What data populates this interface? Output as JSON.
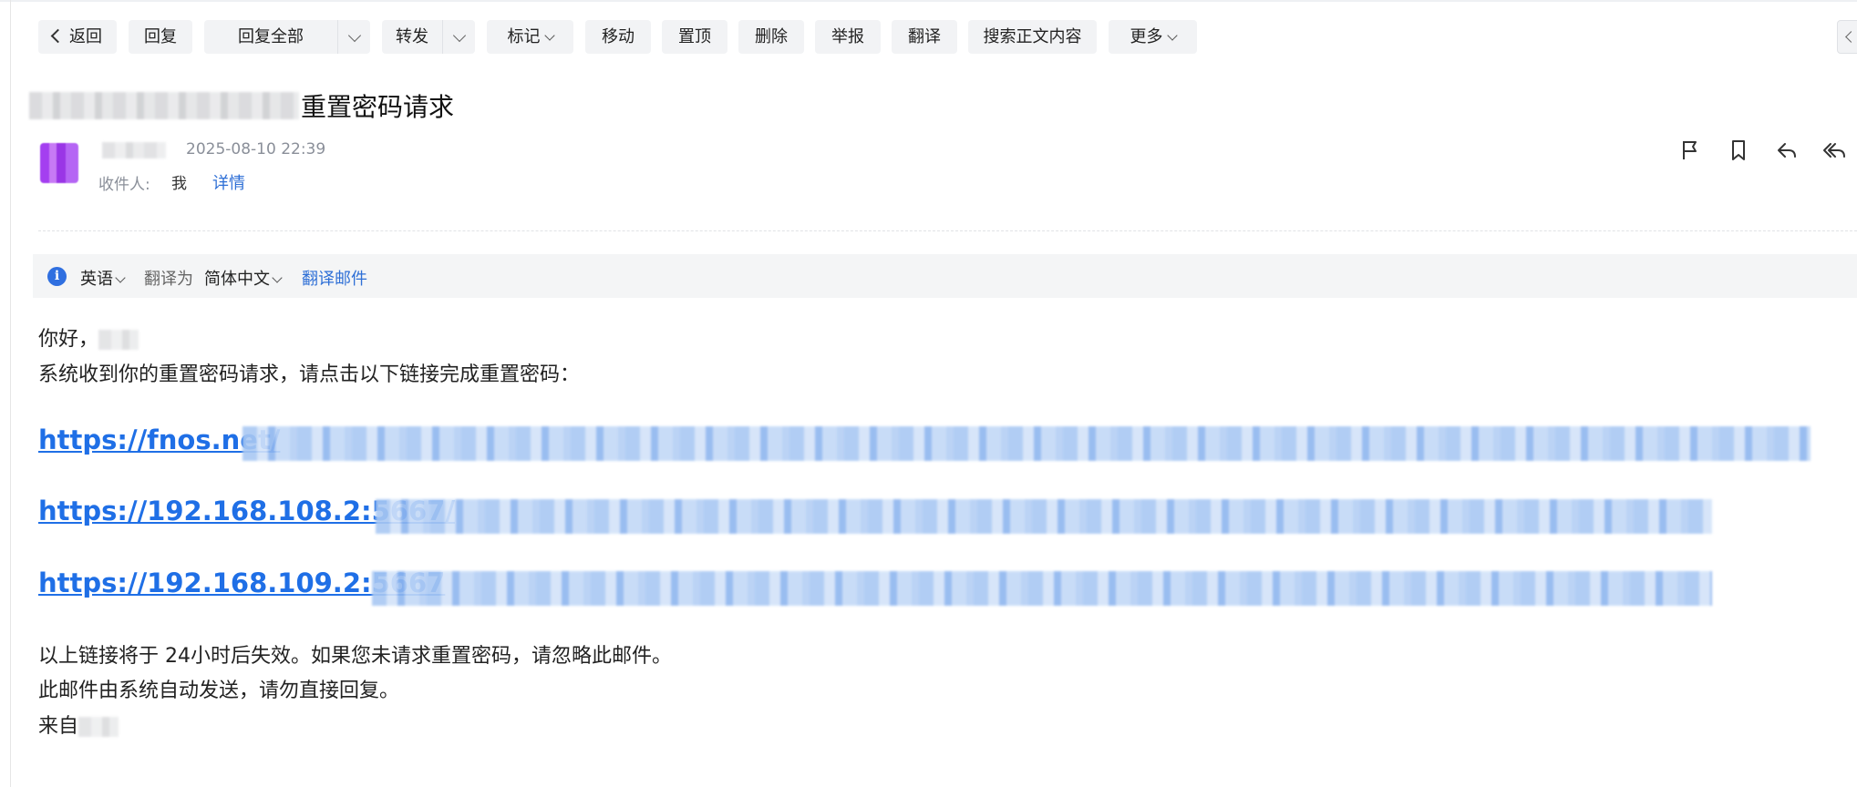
{
  "toolbar": {
    "back": "返回",
    "reply": "回复",
    "reply_all": "回复全部",
    "forward": "转发",
    "mark": "标记",
    "move": "移动",
    "pin": "置顶",
    "delete": "删除",
    "report": "举报",
    "translate": "翻译",
    "search_body": "搜索正文内容",
    "more": "更多"
  },
  "email": {
    "subject": "重置密码请求",
    "date": "2025-08-10 22:39",
    "recipient_label": "收件人:",
    "recipient": "我",
    "detail_link": "详情"
  },
  "actions": [
    "flag-icon",
    "bookmark-icon",
    "reply-icon",
    "reply-all-icon"
  ],
  "translate_bar": {
    "source_lang": "英语",
    "translate_to": "翻译为",
    "target_lang": "简体中文",
    "translate_link": "翻译邮件"
  },
  "body": {
    "greeting": "你好，",
    "line1": "系统收到你的重置密码请求，请点击以下链接完成重置密码：",
    "links": [
      "https://fnos.net/",
      "https://192.168.108.2:5667/",
      "https://192.168.109.2:5667"
    ],
    "line2": "以上链接将于 24小时后失效。如果您未请求重置密码，请忽略此邮件。",
    "line3": "此邮件由系统自动发送，请勿直接回复。",
    "signature_prefix": "来自"
  },
  "colors": {
    "link": "#1f6fe6",
    "accent": "#2e6fd6",
    "toolbar_bg": "#f2f3f5"
  }
}
